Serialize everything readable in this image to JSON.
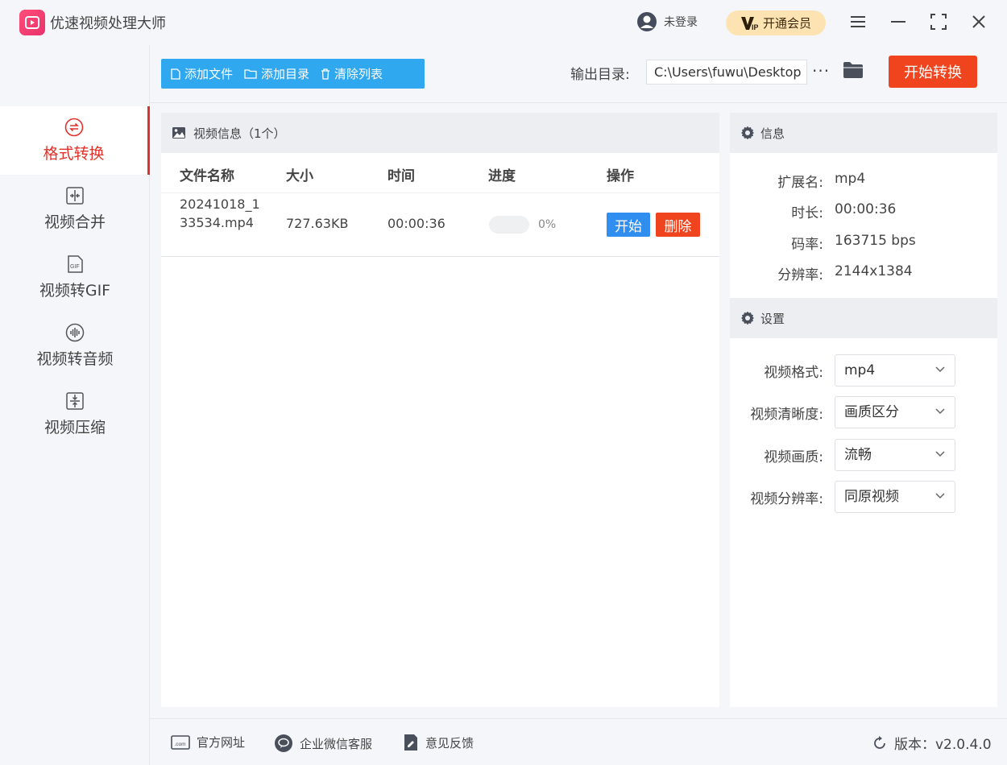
{
  "app": {
    "title": "优速视频处理大师"
  },
  "user": {
    "login_text": "未登录"
  },
  "vip": {
    "label": "开通会员"
  },
  "sidebar": {
    "items": [
      {
        "label": "格式转换",
        "icon": "convert-icon",
        "active": true
      },
      {
        "label": "视频合并",
        "icon": "merge-icon"
      },
      {
        "label": "视频转GIF",
        "icon": "gif-icon"
      },
      {
        "label": "视频转音频",
        "icon": "audio-icon"
      },
      {
        "label": "视频压缩",
        "icon": "compress-icon"
      }
    ]
  },
  "toolbar": {
    "add_file": "添加文件",
    "add_dir": "添加目录",
    "clear_list": "清除列表",
    "output_label": "输出目录:",
    "output_path": "C:\\Users\\fuwu\\Desktop",
    "more": "···",
    "start_all": "开始转换"
  },
  "list": {
    "header": "视频信息（1个）",
    "columns": [
      "文件名称",
      "大小",
      "时间",
      "进度",
      "操作"
    ],
    "rows": [
      {
        "name": "20241018_133534.mp4",
        "size": "727.63KB",
        "time": "00:00:36",
        "progress": 0,
        "progress_text": "0%",
        "start": "开始",
        "delete": "删除"
      }
    ]
  },
  "info": {
    "header": "信息",
    "ext_label": "扩展名:",
    "ext": "mp4",
    "duration_label": "时长:",
    "duration": "00:00:36",
    "bitrate_label": "码率:",
    "bitrate": "163715 bps",
    "resolution_label": "分辨率:",
    "resolution": "2144x1384"
  },
  "settings": {
    "header": "设置",
    "format_label": "视频格式:",
    "format": "mp4",
    "clarity_label": "视频清晰度:",
    "clarity": "画质区分",
    "quality_label": "视频画质:",
    "quality": "流畅",
    "res_label": "视频分辨率:",
    "res": "同原视频"
  },
  "footer": {
    "website": "官方网址",
    "wechat": "企业微信客服",
    "feedback": "意见反馈",
    "version": "版本：v2.0.4.0"
  },
  "colors": {
    "accent": "#30a8f0",
    "danger": "#f0441e",
    "active": "#e0322a",
    "vip": "#fde3b1"
  }
}
